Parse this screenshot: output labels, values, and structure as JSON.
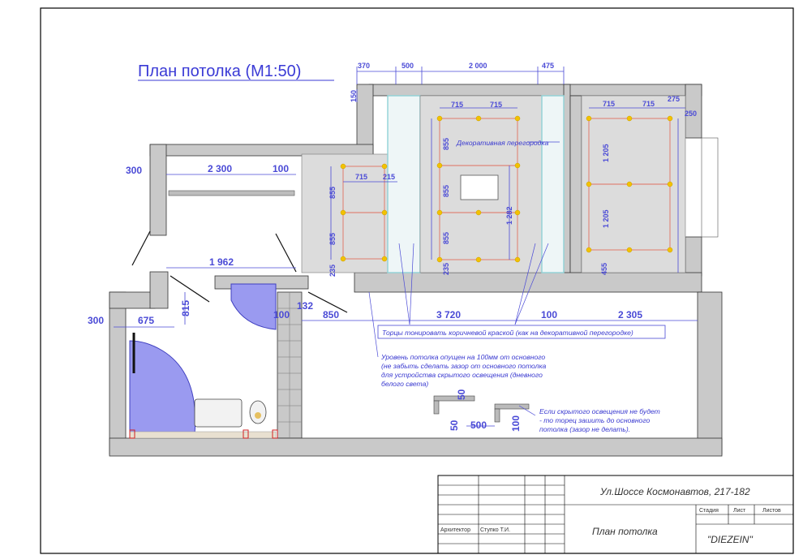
{
  "title": "План потолка  (М1:50)",
  "dimensions": {
    "top": [
      "370",
      "500",
      "2 000",
      "475"
    ],
    "top_left_small": "150",
    "left_room": [
      "300",
      "2 300",
      "100"
    ],
    "hall": "1 962",
    "hall_vertical": "815",
    "bathroom": [
      "300",
      "675"
    ],
    "hall_small": [
      "100",
      "132",
      "850"
    ],
    "bottom_row": [
      "3 720",
      "100",
      "2 305"
    ],
    "room2_horizontal": [
      "715",
      "215"
    ],
    "room2_vertical": [
      "855",
      "855",
      "235"
    ],
    "room3_horizontal": [
      "715",
      "715"
    ],
    "room3_vertical": [
      "855",
      "855",
      "855",
      "235"
    ],
    "room3_long": "1 282",
    "room4_horizontal": [
      "715",
      "715",
      "275"
    ],
    "room4_side": "250",
    "room4_vertical": [
      "1 205",
      "1 205",
      "455"
    ],
    "detail": [
      "50",
      "50",
      "500",
      "100"
    ]
  },
  "annotations": {
    "decorative_partition": "Декоративная перегородка",
    "edges": "Торцы тонировать коричневой краской (как на декоративной перегородке)",
    "lowered_ceiling": [
      "Уровень потолка опущен на 100мм от основного",
      "(не забыть сделать зазор от основного потолка",
      "для устройства скрытого освещения (дневного",
      "белого света)"
    ],
    "no_lighting": [
      "Если скрытого освещения не будет",
      "- то торец зашить  до основного",
      "потолка (зазор не делать)."
    ]
  },
  "title_block": {
    "address": "Ул.Шоссе Космонавтов, 217-182",
    "sheet_name": "План потолка",
    "stage_label": "Стадия",
    "sheet_label": "Лист",
    "sheets_label": "Листов",
    "company": "\"DIEZEIN\"",
    "architect_label": "Архитектор",
    "architect_name": "Ступко Т.И."
  },
  "colors": {
    "dimension": "#4a4ad6",
    "wall": "#c9c9c9",
    "light_point": "#f2c200",
    "layout_line": "#e07060",
    "fixture": "#9a9af0"
  }
}
